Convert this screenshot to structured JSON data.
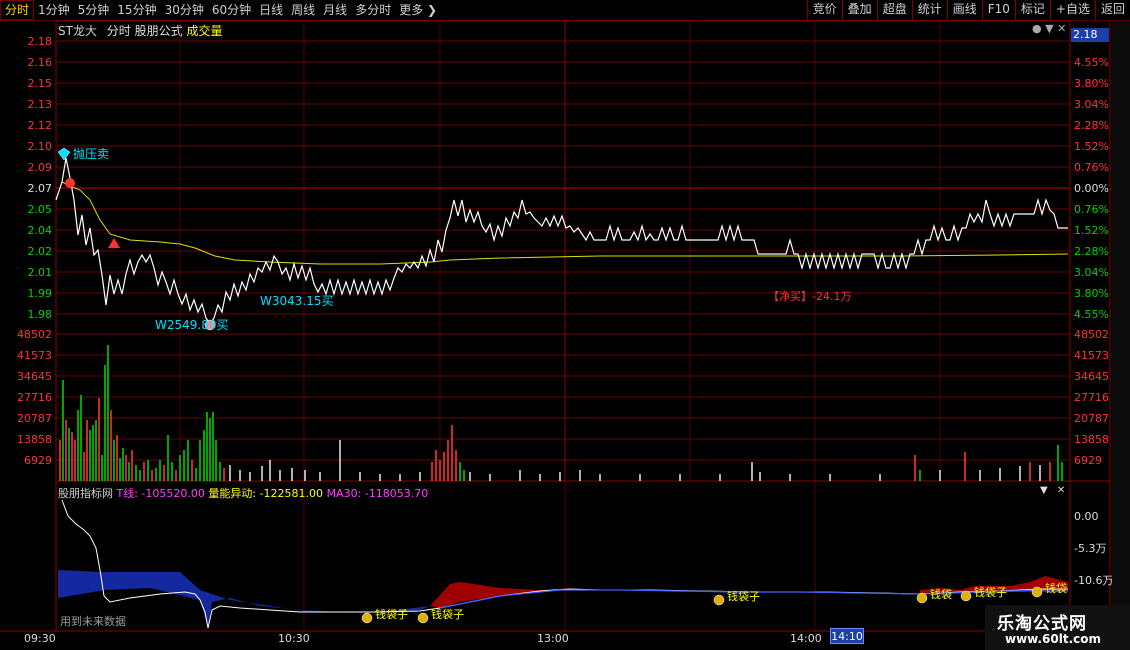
{
  "toolbar": {
    "tabs": [
      "分时",
      "1分钟",
      "5分钟",
      "15分钟",
      "30分钟",
      "60分钟",
      "日线",
      "周线",
      "月线",
      "多分时",
      "更多"
    ],
    "active_tab": "分时",
    "buttons": [
      "竞价",
      "叠加",
      "超盘",
      "统计",
      "画线",
      "F10",
      "标记",
      "+自选",
      "返回"
    ]
  },
  "header": {
    "stock_name": "ST龙大",
    "chart_label": "分时",
    "formula_label": "股朋公式",
    "volume_label": "成交量"
  },
  "price_axis": {
    "left_labels": [
      "2.18",
      "2.16",
      "2.15",
      "2.13",
      "2.12",
      "2.10",
      "2.09",
      "2.07",
      "2.05",
      "2.04",
      "2.02",
      "2.01",
      "1.99",
      "1.98"
    ],
    "right_labels": [
      "2.18",
      "4.55%",
      "3.80%",
      "3.04%",
      "2.28%",
      "1.52%",
      "0.76%",
      "0.00%",
      "0.76%",
      "1.52%",
      "2.28%",
      "3.04%",
      "3.80%",
      "4.55%"
    ],
    "current_value": "2.18"
  },
  "volume_axis": {
    "labels": [
      "48502",
      "41573",
      "34645",
      "27716",
      "20787",
      "13858",
      "6929"
    ]
  },
  "annotations": {
    "top_signal": "抛压卖",
    "low_signal": "W2549.80买",
    "mid_signal": "W3043.15买",
    "net_label": "【净买】-24.1万"
  },
  "indicator": {
    "name": "股朋指标网",
    "t_line_label": "T线: -105520.00",
    "vol_label": "量能异动: -122581.00",
    "ma_label": "MA30: -118053.70",
    "axis_labels": [
      "0.00",
      "-5.3万",
      "-10.6万"
    ],
    "future_data": "用到未来数据",
    "money_bag_label": "钱袋子",
    "money_bag_partial": "钱袋"
  },
  "time_axis": {
    "labels": [
      "09:30",
      "10:30",
      "13:00",
      "14:00"
    ],
    "cursor_time": "14:10"
  },
  "watermark": {
    "title": "乐淘公式网",
    "url": "www.60lt.com"
  },
  "colors": {
    "up_red": "#ff3232",
    "down_green": "#00d000",
    "neutral": "#dcdcdc",
    "grid_red": "#8a0000",
    "avg_line": "#e0e000",
    "price_line": "#ffffff",
    "cyan_text": "#00e0ff",
    "t_line": "#ff40ff",
    "vol_label": "#ffff00",
    "ma_label": "#ff40ff",
    "blue_area": "#1428a0",
    "red_area": "#a00000"
  },
  "icons": [
    "menu-arrow-icon",
    "dropdown-arrow-icon",
    "close-icon",
    "diamond-icon",
    "money-bag-icon",
    "up-triangle-icon"
  ]
}
